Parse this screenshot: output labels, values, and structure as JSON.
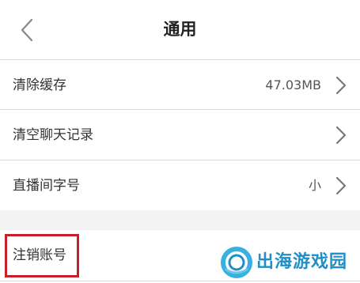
{
  "header": {
    "title": "通用",
    "back_icon": "chevron-left-icon"
  },
  "settings": {
    "clear_cache": {
      "label": "清除缓存",
      "value": "47.03MB"
    },
    "clear_chat": {
      "label": "清空聊天记录"
    },
    "font_size": {
      "label": "直播间字号",
      "value": "小"
    },
    "cancel_account": {
      "label": "注销账号"
    }
  },
  "watermark": {
    "text": "出海游戏园"
  },
  "colors": {
    "highlight_border": "#c8202a",
    "watermark": "#1f8fc8",
    "section_gap": "#f3f3f3",
    "divider": "#dcdcdc"
  }
}
